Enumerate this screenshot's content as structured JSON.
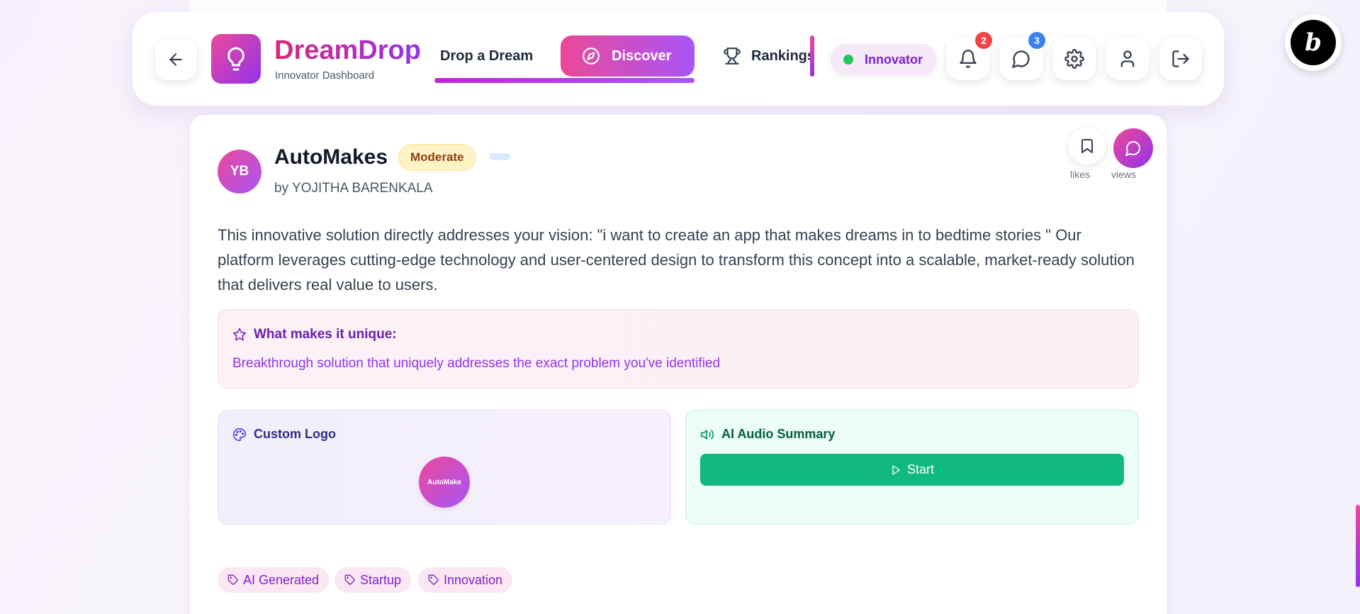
{
  "header": {
    "brand_name": "DreamDrop",
    "brand_subtitle": "Innovator Dashboard",
    "tabs": [
      {
        "label": "Drop a Dream"
      },
      {
        "label": "Discover"
      },
      {
        "label": "Rankings"
      }
    ],
    "active_tab": "Discover",
    "role_label": "Innovator",
    "notifications_count": "2",
    "messages_count": "3"
  },
  "idea": {
    "avatar_initials": "YB",
    "title": "AutoMakes",
    "difficulty": "Moderate",
    "author": "by YOJITHA BARENKALA",
    "likes_label": "likes",
    "views_label": "views",
    "description": "This innovative solution directly addresses your vision: \"i want to create an app that makes dreams in to bedtime stories \" Our platform leverages cutting-edge technology and user-centered design to transform this concept into a scalable, market-ready solution that delivers real value to users.",
    "unique_title": "What makes it unique:",
    "unique_text": "Breakthrough solution that uniquely addresses the exact problem you've identified",
    "logo_panel_title": "Custom Logo",
    "logo_text": "AutoMake",
    "audio_panel_title": "AI Audio Summary",
    "audio_button": "Start",
    "tags": [
      "AI Generated",
      "Startup",
      "Innovation"
    ]
  },
  "colors": {
    "brand_pink": "#ec4899",
    "brand_purple": "#9333ea",
    "success_green": "#10b981",
    "badge_red": "#ef4444",
    "badge_blue": "#3b82f6"
  }
}
